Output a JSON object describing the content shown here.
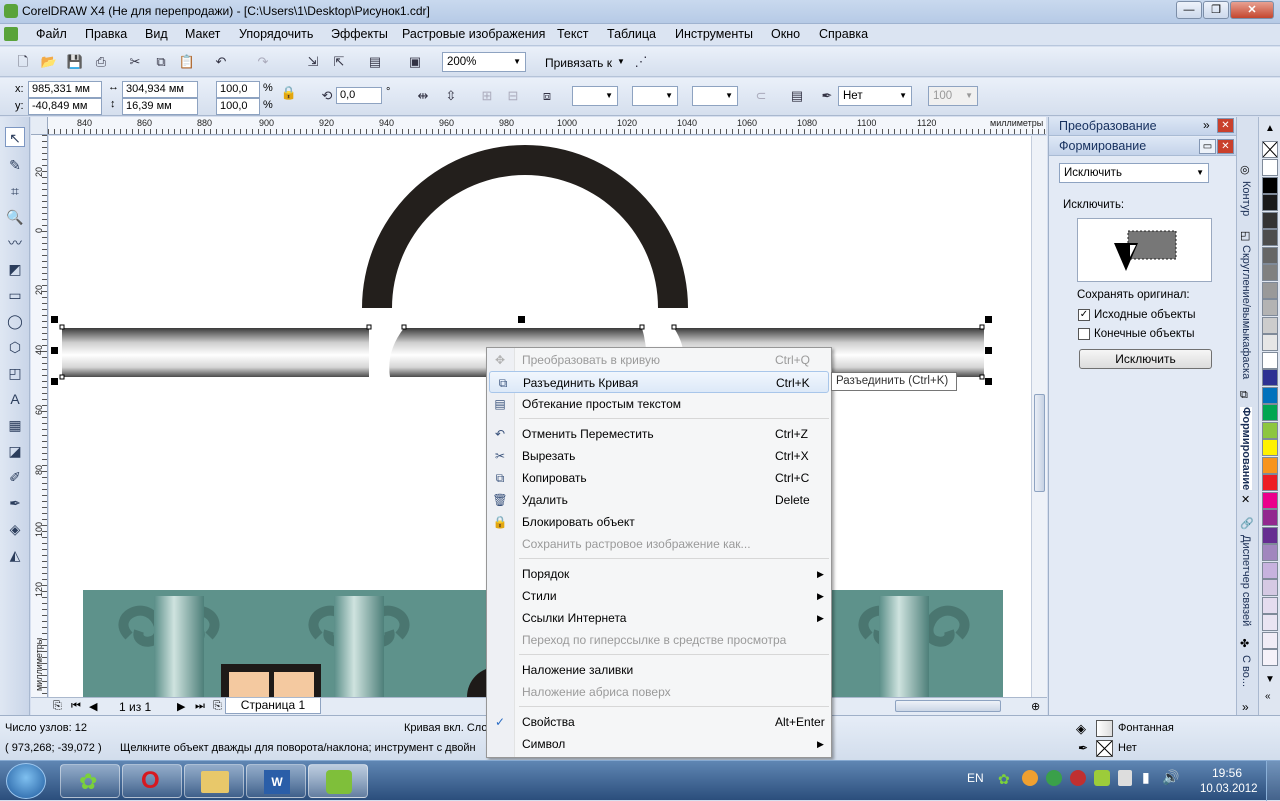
{
  "window": {
    "title": "CorelDRAW X4 (Не для перепродажи) - [C:\\Users\\1\\Desktop\\Рисунок1.cdr]",
    "min": "—",
    "max": "❐",
    "close": "✕"
  },
  "menu": [
    "Файл",
    "Правка",
    "Вид",
    "Макет",
    "Упорядочить",
    "Эффекты",
    "Растровые изображения",
    "Текст",
    "Таблица",
    "Инструменты",
    "Окно",
    "Справка"
  ],
  "toolbar": {
    "zoom": "200%",
    "snap": "Привязать к"
  },
  "props": {
    "x_label": "x:",
    "x": "985,331 мм",
    "y_label": "y:",
    "y": "-40,849 мм",
    "w": "304,934 мм",
    "h": "16,39 мм",
    "sx": "100,0",
    "sy": "100,0",
    "pct": "%",
    "angle": "0,0",
    "deg": "°",
    "outline": "Нет",
    "pct2": "100"
  },
  "ruler": {
    "h_ticks": [
      "840",
      "860",
      "880",
      "900",
      "920",
      "940",
      "960",
      "980",
      "1000",
      "1020",
      "1040",
      "1060",
      "1080",
      "1100",
      "1120"
    ],
    "h_unit": "миллиметры",
    "v_ticks": [
      "20",
      "0",
      "20",
      "40",
      "60",
      "80",
      "100",
      "120"
    ],
    "v_unit": "миллиметры"
  },
  "pagebar": {
    "page_of": "1 из 1",
    "page_tab": "Страница 1"
  },
  "docker": {
    "transform": "Преобразование",
    "shaping": "Формирование",
    "mode": "Исключить",
    "mode_label": "Исключить:",
    "keep_label": "Сохранять оригинал:",
    "source_cb": "Исходные объекты",
    "target_cb": "Конечные объекты",
    "apply": "Исключить"
  },
  "vtabs": [
    "Контур",
    "Скругление/вымыкафаска",
    "Формирование",
    "Диспетчер связей",
    "С во..."
  ],
  "status": {
    "nodes": "Число узлов: 12",
    "curve": "Кривая вкл. Сло",
    "coords": "( 973,268; -39,072 )",
    "hint": "Щелкните объект дважды для поворота/наклона; инструмент с двойн",
    "fill": "Фонтанная",
    "outline": "Нет"
  },
  "context_menu": [
    {
      "label": "Преобразовать в кривую",
      "shortcut": "Ctrl+Q",
      "disabled": true,
      "icon": "convert-curve-icon"
    },
    {
      "label": "Разъединить Кривая",
      "shortcut": "Ctrl+K",
      "highlight": true,
      "icon": "break-apart-icon"
    },
    {
      "label": "Обтекание простым текстом",
      "shortcut": "",
      "icon": "text-wrap-icon"
    },
    {
      "sep": true
    },
    {
      "label": "Отменить Переместить",
      "shortcut": "Ctrl+Z",
      "icon": "undo-icon"
    },
    {
      "label": "Вырезать",
      "shortcut": "Ctrl+X",
      "icon": "cut-icon"
    },
    {
      "label": "Копировать",
      "shortcut": "Ctrl+C",
      "icon": "copy-icon"
    },
    {
      "label": "Удалить",
      "shortcut": "Delete",
      "icon": "delete-icon"
    },
    {
      "label": "Блокировать объект",
      "shortcut": "",
      "icon": "lock-icon"
    },
    {
      "label": "Сохранить растровое изображение как...",
      "shortcut": "",
      "disabled": true
    },
    {
      "sep": true
    },
    {
      "label": "Порядок",
      "submenu": true
    },
    {
      "label": "Стили",
      "submenu": true
    },
    {
      "label": "Ссылки Интернета",
      "submenu": true
    },
    {
      "label": "Переход по гиперссылке в средстве просмотра",
      "disabled": true
    },
    {
      "sep": true
    },
    {
      "label": "Наложение заливки",
      "shortcut": ""
    },
    {
      "label": "Наложение абриса поверх",
      "disabled": true
    },
    {
      "sep": true
    },
    {
      "label": "Свойства",
      "shortcut": "Alt+Enter",
      "checked": true
    },
    {
      "label": "Символ",
      "submenu": true
    }
  ],
  "tooltip": "Разъединить (Ctrl+K)",
  "taskbar": {
    "lang": "EN",
    "time": "19:56",
    "date": "10.03.2012"
  },
  "colors": {
    "palette": [
      "#ffffff",
      "#000000",
      "#1a1a1a",
      "#333333",
      "#4d4d4d",
      "#666666",
      "#808080",
      "#999999",
      "#b3b3b3",
      "#cccccc",
      "#e6e6e6",
      "#ffffff",
      "#2e3192",
      "#0071bc",
      "#00a651",
      "#8dc63f",
      "#fff200",
      "#f7941d",
      "#ed1c24",
      "#ec008c",
      "#92278f",
      "#662d91",
      "#a186be",
      "#c7b2de",
      "#d5c9e3",
      "#e5dcef",
      "#eae4f2",
      "#f0ecf6",
      "#f5f2f9"
    ]
  }
}
